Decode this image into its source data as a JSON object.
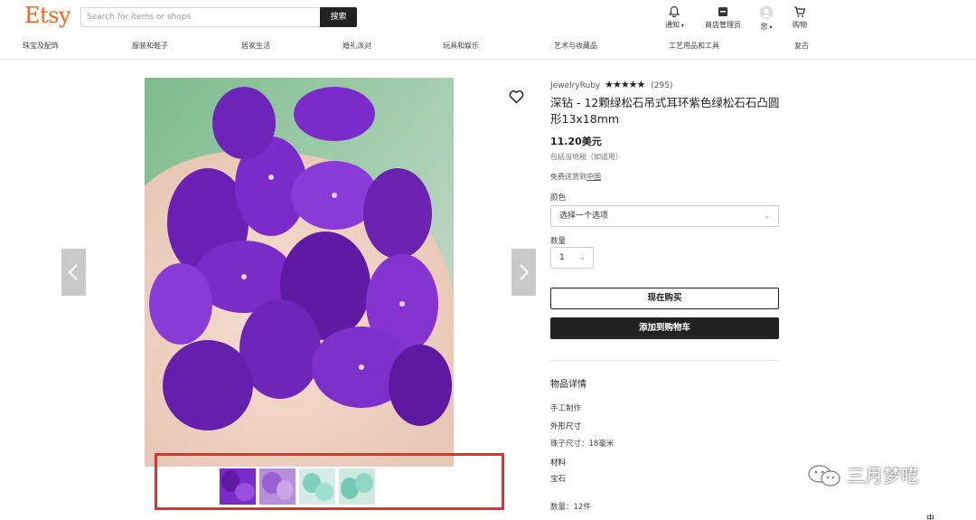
{
  "header": {
    "logo": "Etsy",
    "search_placeholder": "Search for items or shops",
    "search_button": "搜索",
    "icons": [
      {
        "label": "通知",
        "icon": "bell-icon"
      },
      {
        "label": "商店管理员",
        "icon": "store-icon"
      },
      {
        "label": "您",
        "icon": "avatar-icon"
      },
      {
        "label": "购物",
        "icon": "cart-icon"
      }
    ]
  },
  "nav": [
    "珠宝及配饰",
    "服装和鞋子",
    "居家生活",
    "婚礼派对",
    "玩具和娱乐",
    "艺术与收藏品",
    "工艺用品和工具",
    "复古"
  ],
  "listing": {
    "shop_name": "JewelryRuby",
    "stars": "★★★★★",
    "review_count": "(295)",
    "title": "深钻 - 12颗绿松石吊式耳环紫色绿松石石凸圆形13x18mm",
    "price": "11.20美元",
    "tax_note": "包括当地税（如适用）",
    "shipping_prefix": "免费送货到",
    "shipping_country": "中国",
    "color_label": "颜色",
    "color_select": "选择一个选项",
    "qty_label": "数量",
    "qty_value": "1",
    "buy_now": "现在购买",
    "add_to_cart": "添加到购物车",
    "details_title": "物品详情",
    "handmade": "手工制作",
    "dimensions_label": "外形尺寸",
    "bead_size": "珠子尺寸：18毫米",
    "materials_label": "材料",
    "material_value": "宝石",
    "quantity_detail": "数量：12件"
  },
  "watermark": "三月梦呓",
  "corner_text": "中"
}
